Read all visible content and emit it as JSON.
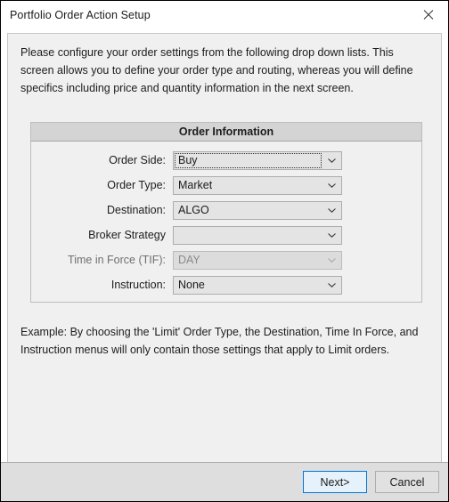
{
  "window": {
    "title": "Portfolio Order Action Setup",
    "close_icon": "close-icon"
  },
  "intro": {
    "text": "Please configure your order settings from the following drop down lists. This screen allows you to define your order type and routing, whereas you will define specifics including price and quantity information in the next screen."
  },
  "group": {
    "header": "Order Information",
    "rows": [
      {
        "label": "Order Side:",
        "value": "Buy",
        "disabled": false,
        "focused": true,
        "name": "order-side"
      },
      {
        "label": "Order Type:",
        "value": "Market",
        "disabled": false,
        "focused": false,
        "name": "order-type"
      },
      {
        "label": "Destination:",
        "value": "ALGO",
        "disabled": false,
        "focused": false,
        "name": "destination"
      },
      {
        "label": "Broker Strategy",
        "value": "",
        "disabled": false,
        "focused": false,
        "name": "broker-strategy"
      },
      {
        "label": "Time in Force (TIF):",
        "value": "DAY",
        "disabled": true,
        "focused": false,
        "name": "time-in-force"
      },
      {
        "label": "Instruction:",
        "value": "None",
        "disabled": false,
        "focused": false,
        "name": "instruction"
      }
    ]
  },
  "example": {
    "text": "Example:  By choosing the 'Limit' Order Type, the Destination, Time In Force, and Instruction menus will only contain those settings that apply to Limit orders."
  },
  "footer": {
    "next_label": "Next>",
    "cancel_label": "Cancel"
  },
  "colors": {
    "accent": "#0078d7",
    "window_bg": "#f0f0f0",
    "group_header": "#d4d4d4",
    "footer_bg": "#dedede"
  }
}
